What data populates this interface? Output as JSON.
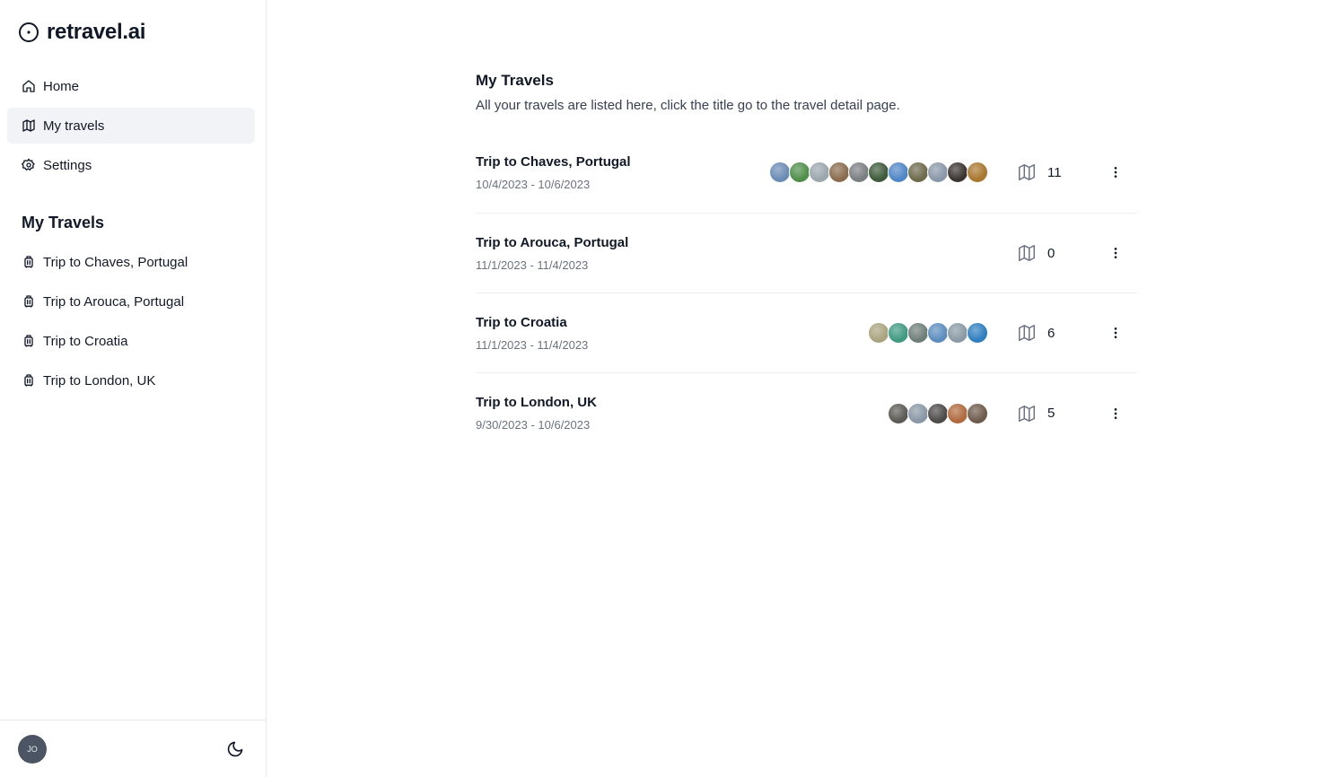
{
  "app": {
    "name": "retravel.ai"
  },
  "nav": [
    {
      "label": "Home",
      "icon": "home-icon",
      "active": false
    },
    {
      "label": "My travels",
      "icon": "map-icon",
      "active": true
    },
    {
      "label": "Settings",
      "icon": "gear-icon",
      "active": false
    }
  ],
  "sidebar_travels": {
    "title": "My Travels",
    "items": [
      {
        "label": "Trip to Chaves, Portugal",
        "icon": "luggage-icon"
      },
      {
        "label": "Trip to Arouca, Portugal",
        "icon": "luggage-icon"
      },
      {
        "label": "Trip to Croatia",
        "icon": "luggage-icon"
      },
      {
        "label": "Trip to London, UK",
        "icon": "luggage-icon"
      }
    ]
  },
  "user": {
    "initials": "JO"
  },
  "main": {
    "title": "My Travels",
    "subtitle": "All your travels are listed here, click the title go to the travel detail page.",
    "travels": [
      {
        "title": "Trip to Chaves, Portugal",
        "dates": "10/4/2023 - 10/6/2023",
        "map_count": "11",
        "photo_colors": [
          "#6b8bb5",
          "#4f8f4a",
          "#9aa6ad",
          "#8a6b4e",
          "#7a7f82",
          "#3e5a3a",
          "#4f86c6",
          "#6e6a4c",
          "#8a97a8",
          "#3b3430",
          "#a9772f"
        ]
      },
      {
        "title": "Trip to Arouca, Portugal",
        "dates": "11/1/2023 - 11/4/2023",
        "map_count": "0",
        "photo_colors": []
      },
      {
        "title": "Trip to Croatia",
        "dates": "11/1/2023 - 11/4/2023",
        "map_count": "6",
        "photo_colors": [
          "#a9a47f",
          "#3f9a82",
          "#6f7d78",
          "#5d8dbf",
          "#8a9aa5",
          "#2f7fc0"
        ]
      },
      {
        "title": "Trip to London, UK",
        "dates": "9/30/2023 - 10/6/2023",
        "map_count": "5",
        "photo_colors": [
          "#5b5a54",
          "#8a97a6",
          "#4d4a48",
          "#b06a3e",
          "#6e5b4c"
        ]
      }
    ]
  },
  "colors": {
    "active_nav_bg": "#f1f3f6",
    "text_primary": "#111827",
    "text_muted": "#6b7280",
    "avatar_bg": "#4b5563"
  }
}
